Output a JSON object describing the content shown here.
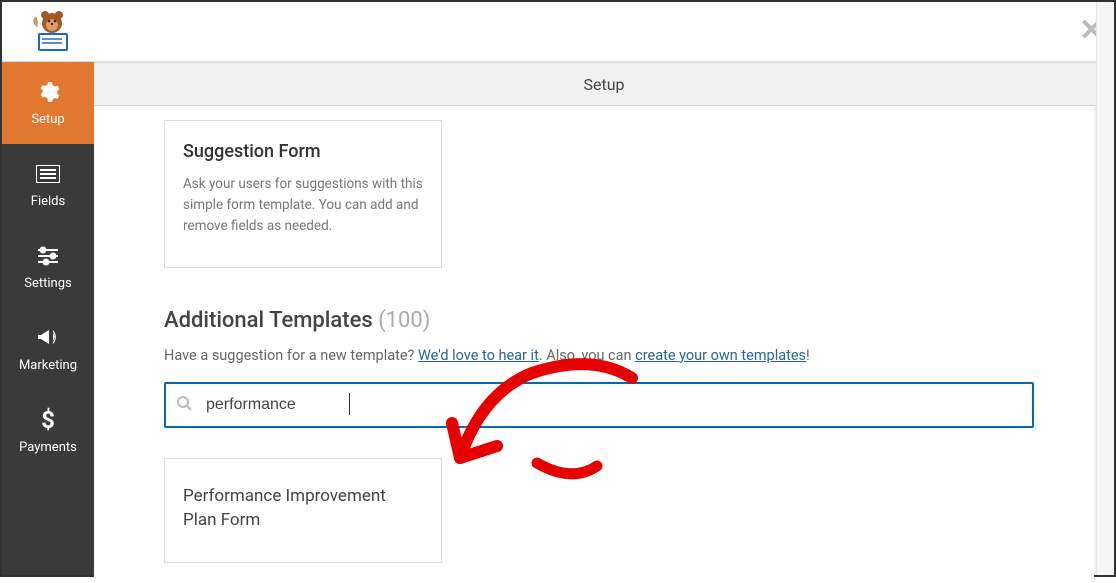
{
  "sidebar": {
    "items": [
      {
        "label": "Setup"
      },
      {
        "label": "Fields"
      },
      {
        "label": "Settings"
      },
      {
        "label": "Marketing"
      },
      {
        "label": "Payments"
      }
    ]
  },
  "tab": {
    "title": "Setup"
  },
  "suggestion_card": {
    "title": "Suggestion Form",
    "desc": "Ask your users for suggestions with this simple form template. You can add and remove fields as needed."
  },
  "additional": {
    "heading": "Additional Templates ",
    "count": "(100)",
    "text_prefix": "Have a suggestion for a new template? ",
    "link1": "We'd love to hear it",
    "text_mid": ". Also, you can ",
    "link2": "create your own templates",
    "text_end": "!"
  },
  "search": {
    "value": "performance"
  },
  "result": {
    "title": "Performance Improvement Plan Form"
  }
}
